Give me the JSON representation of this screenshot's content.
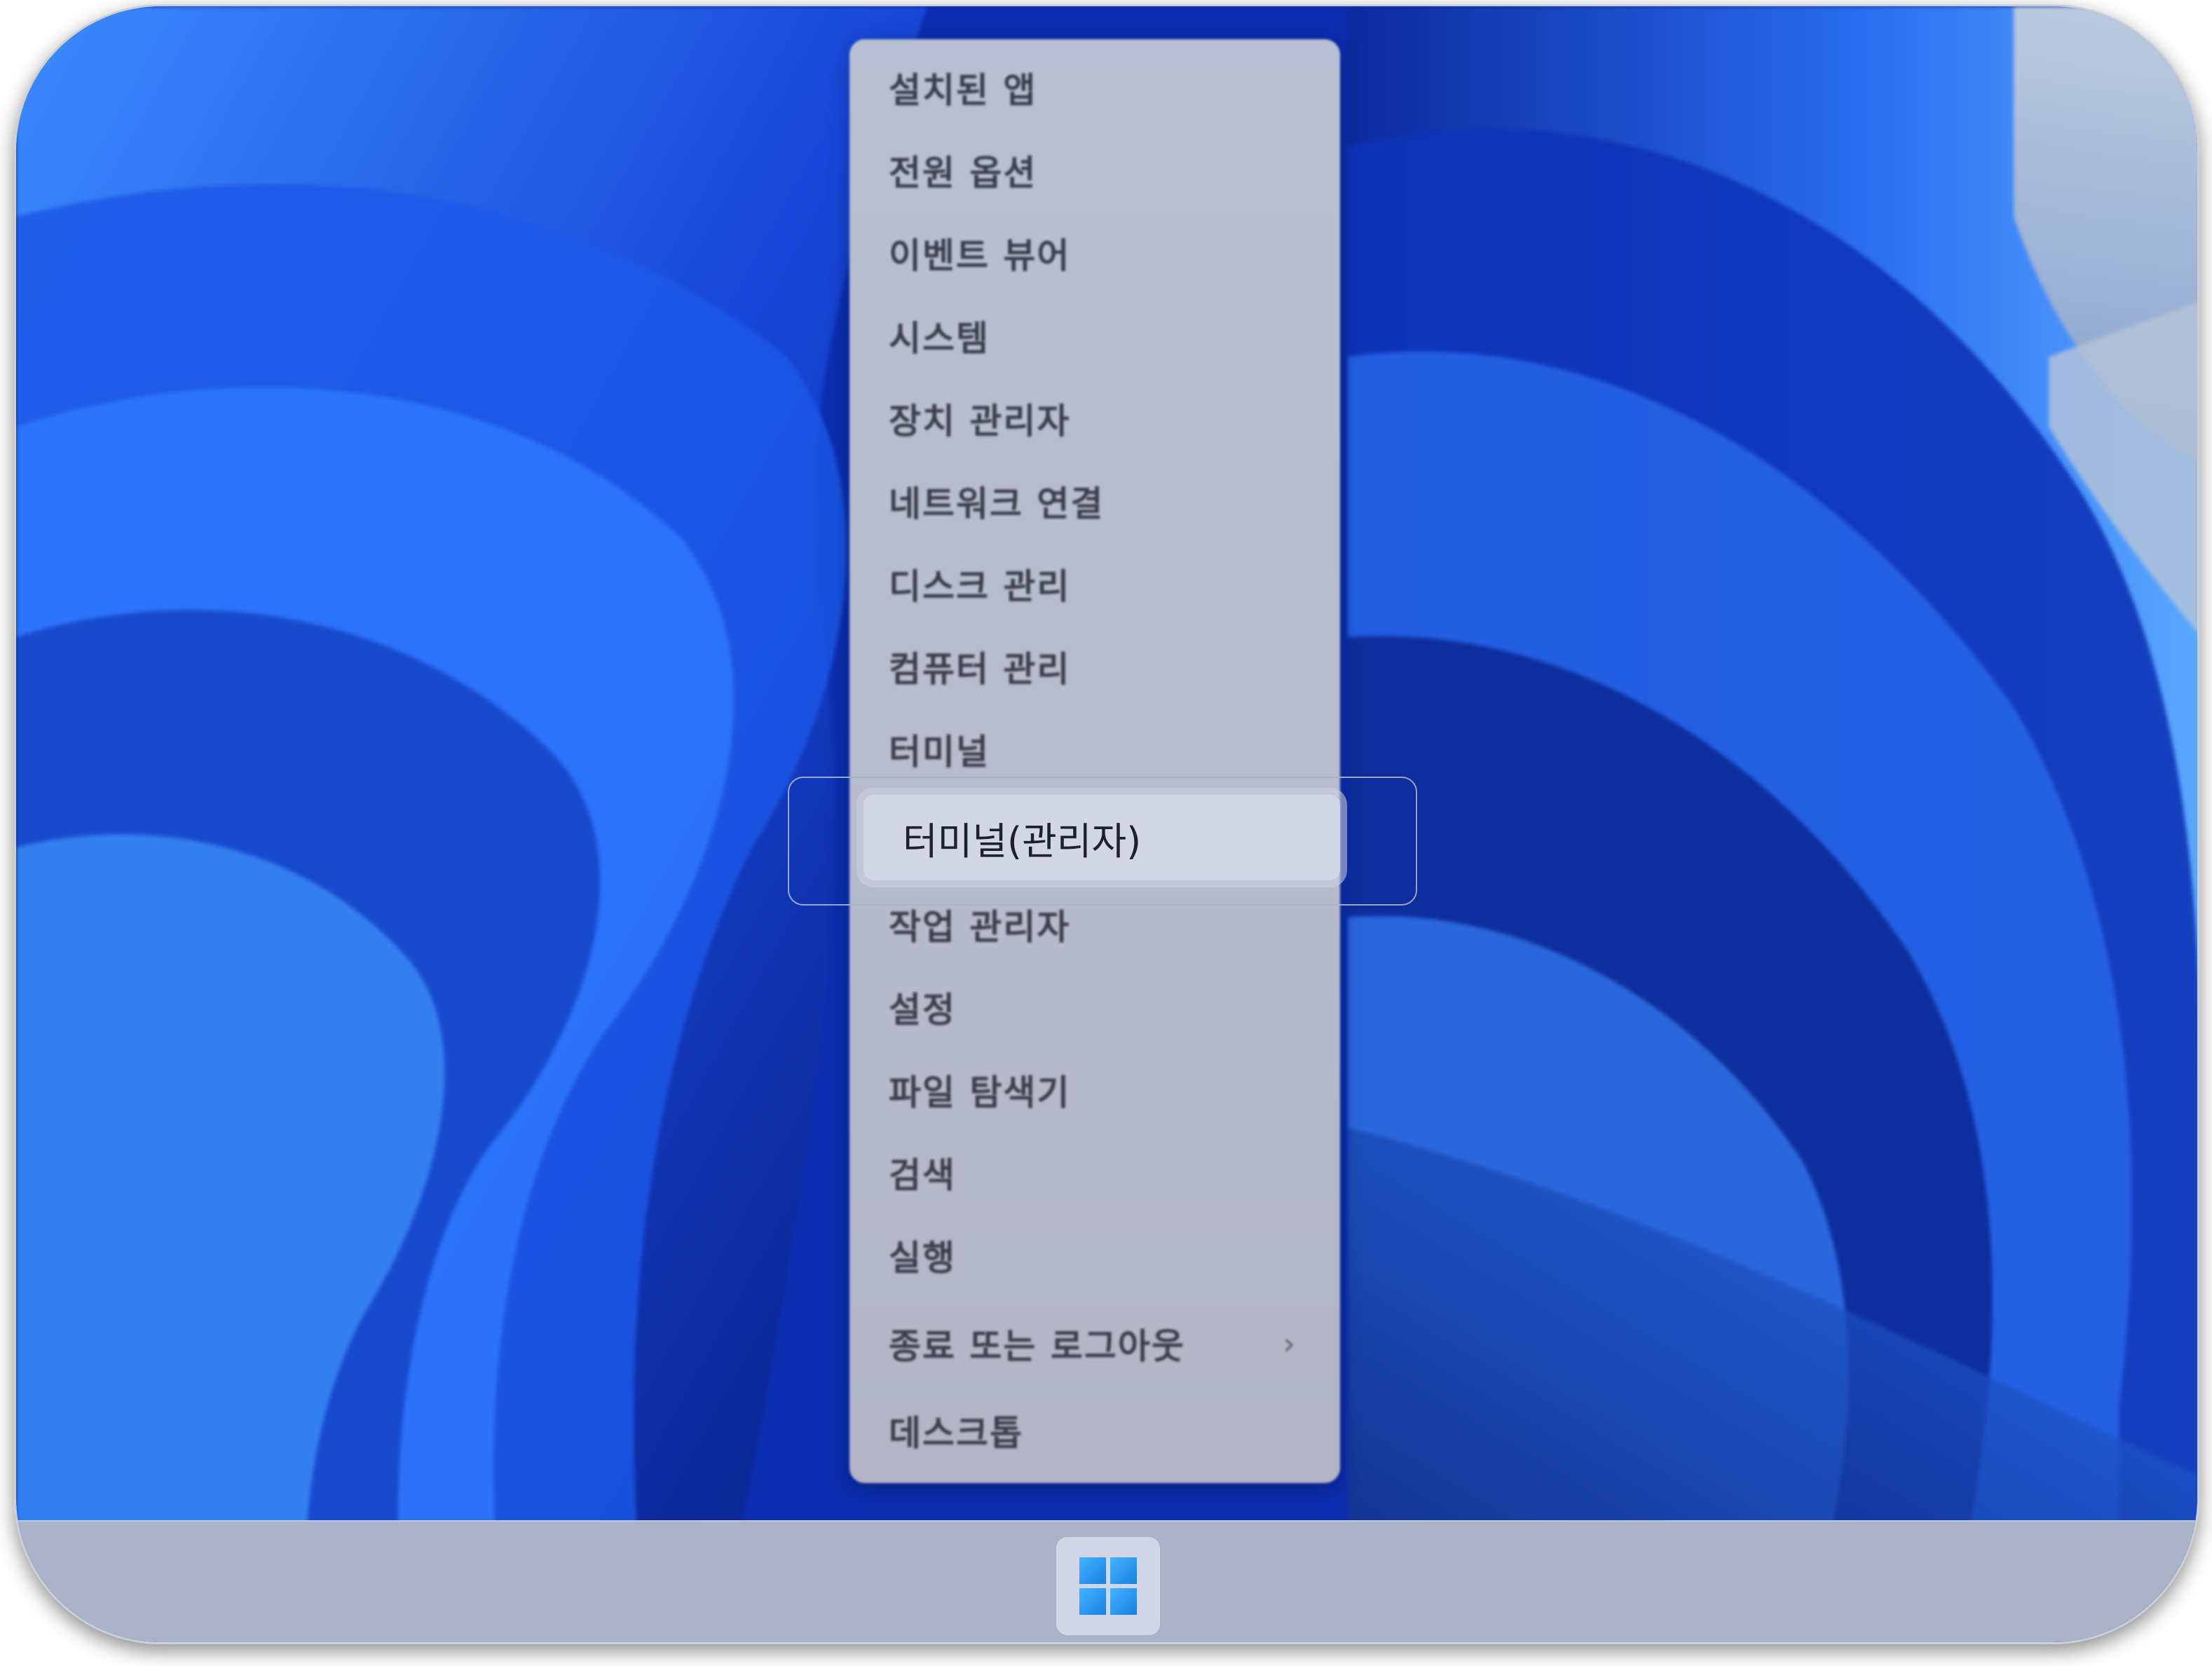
{
  "context_menu": {
    "items": [
      {
        "label": "설치된 앱"
      },
      {
        "label": "전원 옵션"
      },
      {
        "label": "이벤트 뷰어"
      },
      {
        "label": "시스템"
      },
      {
        "label": "장치 관리자"
      },
      {
        "label": "네트워크 연결"
      },
      {
        "label": "디스크 관리"
      },
      {
        "label": "컴퓨터 관리"
      },
      {
        "label": "터미널"
      },
      {
        "label": "터미널(관리자)",
        "highlighted": true
      },
      {
        "label": "작업 관리자"
      },
      {
        "label": "설정"
      },
      {
        "label": "파일 탐색기"
      },
      {
        "label": "검색"
      },
      {
        "label": "실행"
      },
      {
        "label": "종료 또는 로그아웃",
        "submenu_arrow": "›"
      },
      {
        "label": "데스크톱"
      }
    ]
  },
  "taskbar": {
    "start_icon": "windows-logo-icon"
  },
  "colors": {
    "wallpaper_blue": "#0a2aa8",
    "accent_blue": "#1b7fe0",
    "menu_background": "#b9bfd2",
    "highlight_background": "#d3d6e4"
  }
}
